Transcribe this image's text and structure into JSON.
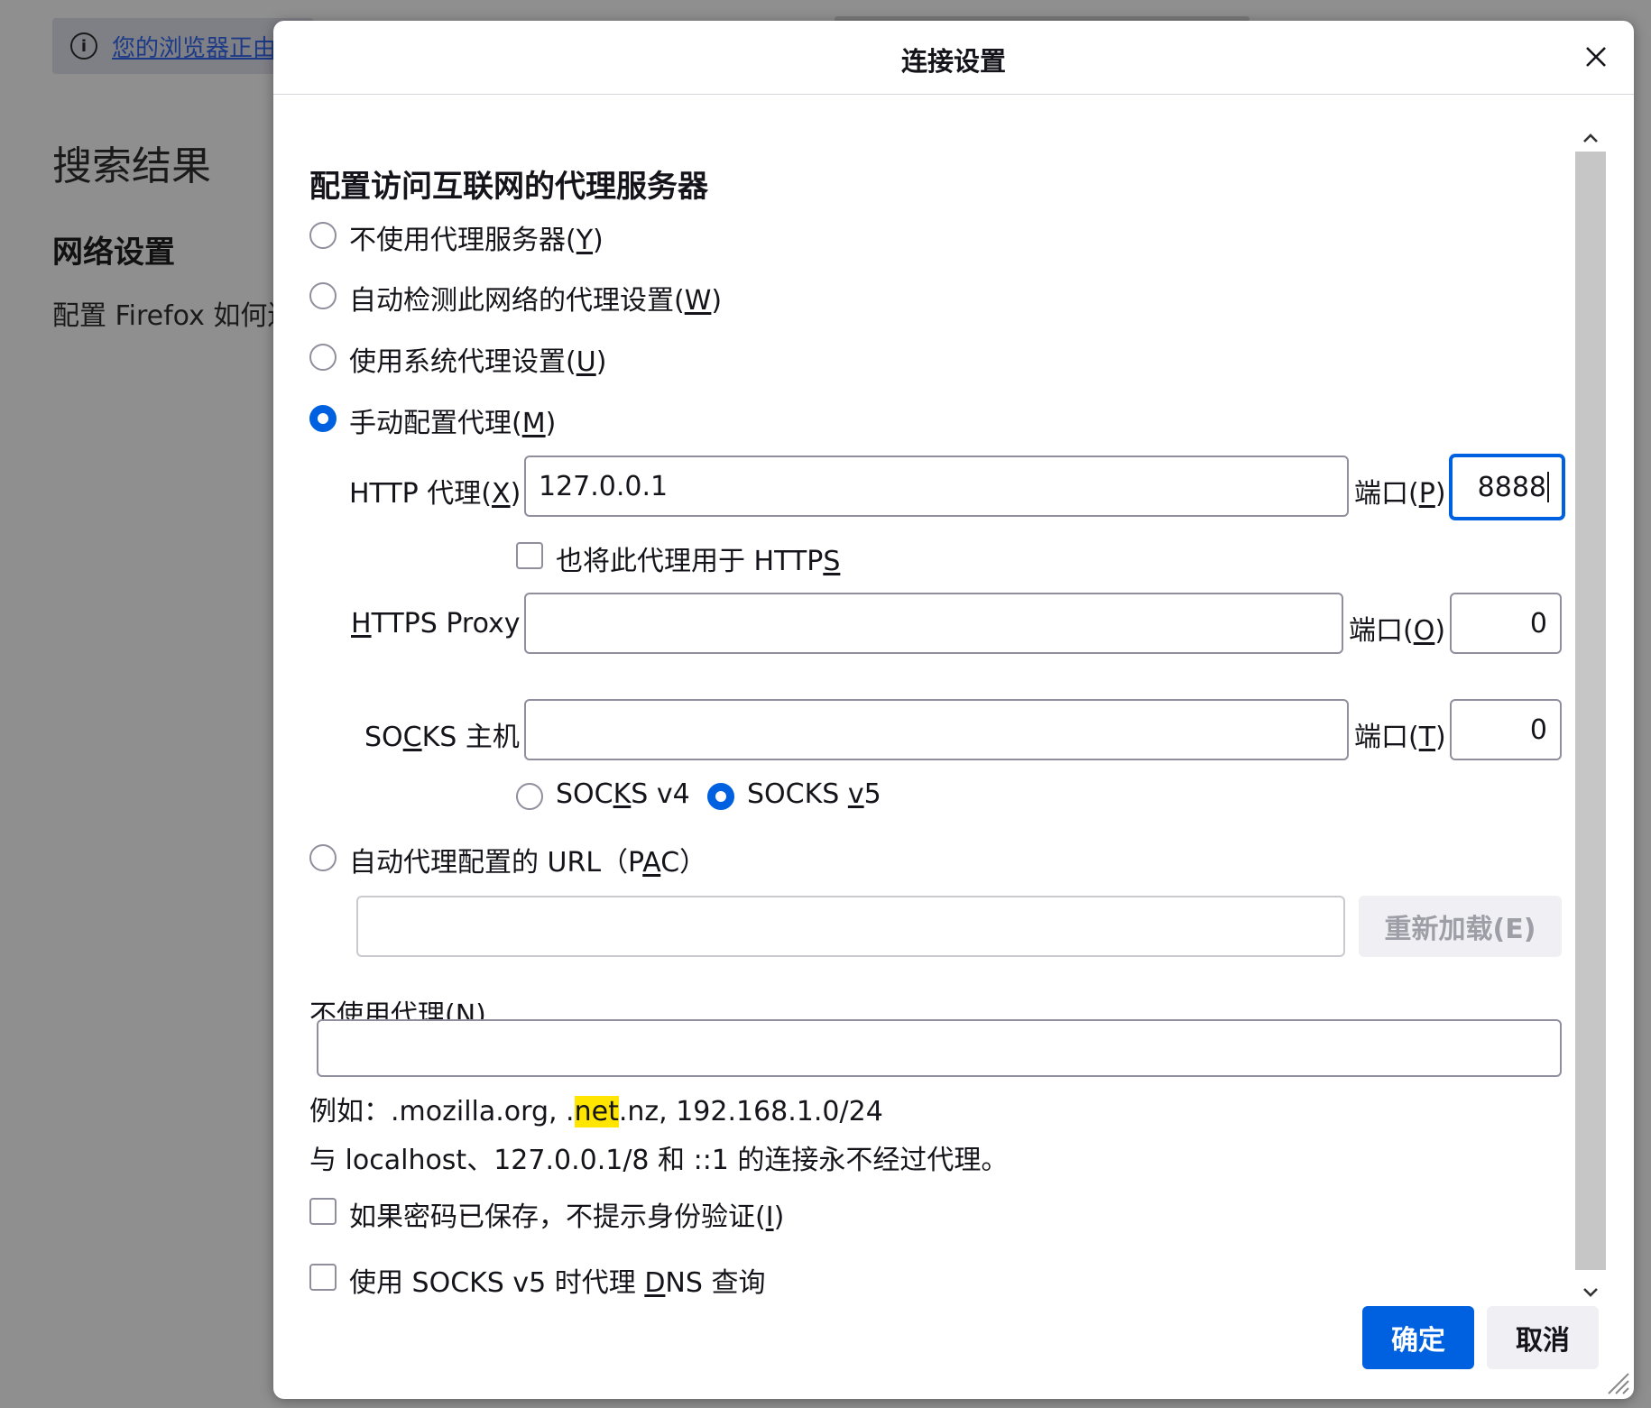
{
  "background": {
    "notice_text": "您的浏览器正由组织管理",
    "search_heading": "搜索结果",
    "network_heading": "网络设置",
    "network_desc": "配置 Firefox 如何连接互联网"
  },
  "dialog": {
    "title": "连接设置",
    "section_title": "配置访问互联网的代理服务器",
    "options": {
      "no_proxy": {
        "text": "不使用代理服务器(",
        "key": "Y",
        "end": ")",
        "selected": false
      },
      "auto_detect": {
        "text": "自动检测此网络的代理设置(",
        "key": "W",
        "end": ")",
        "selected": false
      },
      "system": {
        "text": "使用系统代理设置(",
        "key": "U",
        "end": ")",
        "selected": false
      },
      "manual": {
        "text": "手动配置代理(",
        "key": "M",
        "end": ")",
        "selected": true
      }
    },
    "http": {
      "label_pre": "HTTP 代理(",
      "label_key": "X",
      "label_end": ")",
      "value": "127.0.0.1",
      "port_pre": "端口(",
      "port_key": "P",
      "port_end": ")",
      "port_value": "8888"
    },
    "also_https": {
      "text": "也将此代理用于 HTTP",
      "key": "S",
      "checked": false
    },
    "https": {
      "label_key": "H",
      "label_rest": "TTPS Proxy",
      "value": "",
      "port_pre": "端口(",
      "port_key": "O",
      "port_end": ")",
      "port_value": "0"
    },
    "socks": {
      "label_pre": "SO",
      "label_key": "C",
      "label_end": "KS 主机",
      "value": "",
      "port_pre": "端口(",
      "port_key": "T",
      "port_end": ")",
      "port_value": "0",
      "v4": {
        "pre": "SOC",
        "key": "K",
        "end": "S v4",
        "selected": false
      },
      "v5": {
        "pre": "SOCKS ",
        "key": "v",
        "end": "5",
        "selected": true
      }
    },
    "pac": {
      "text_pre": "自动代理配置的 URL（P",
      "key": "A",
      "text_end": "C）",
      "selected": false,
      "value": "",
      "reload_label": "重新加载(E)"
    },
    "no_proxy_for": {
      "label_pre": "不使用代理(",
      "key": "N",
      "label_end": ")",
      "value": "",
      "example_pre": "例如：.mozilla.org, .",
      "example_hl": "net",
      "example_post": ".nz, 192.168.1.0/24",
      "note": "与 localhost、127.0.0.1/8 和 ::1 的连接永不经过代理。"
    },
    "no_auth_prompt": {
      "text": "如果密码已保存，不提示身份验证(",
      "key": "I",
      "end": ")",
      "checked": false
    },
    "socks_dns": {
      "pre": "使用 SOCKS v5 时代理 ",
      "key": "D",
      "end": "NS 查询",
      "checked": false
    },
    "ok_label": "确定",
    "cancel_label": "取消"
  },
  "colors": {
    "accent": "#0061e0",
    "highlight": "#ffe500",
    "overlay": "#8f8f8f"
  }
}
